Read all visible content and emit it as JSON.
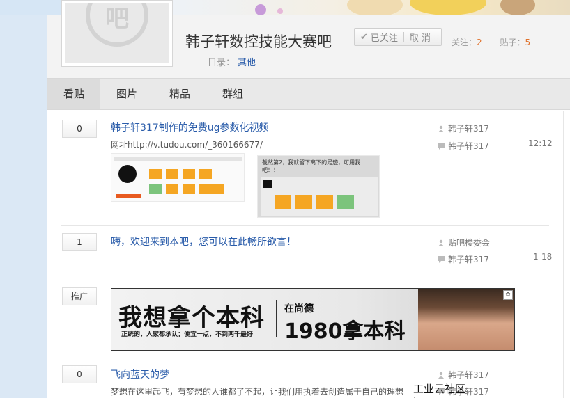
{
  "forum": {
    "title": "韩子轩数控技能大赛吧",
    "avatar_glyph": "吧",
    "follow": {
      "followed_label": "已关注",
      "cancel_label": "取 消"
    },
    "stats": {
      "follow_label": "关注：",
      "follow_count": "2",
      "post_label": "贴子：",
      "post_count": "5"
    },
    "catalog": {
      "label": "目录：",
      "value": "其他"
    }
  },
  "nav": {
    "tabs": [
      "看贴",
      "图片",
      "精品",
      "群组"
    ],
    "active": "看贴"
  },
  "threads": [
    {
      "replies": "0",
      "title": "韩子轩317制作的免费ug参数化视频",
      "excerpt": "网址http://v.tudou.com/_360166677/",
      "author": "韩子轩317",
      "last_reply": "韩子轩317",
      "time": "12:12",
      "thumb2_caption": "截然第2，我就留下离下的足迹，可用我吧！！"
    },
    {
      "replies": "1",
      "title": "嗨，欢迎来到本吧，您可以在此畅所欲言！",
      "author": "贴吧楼委会",
      "last_reply": "韩子轩317",
      "time": "1-18"
    },
    {
      "replies": "推广",
      "ad": {
        "main": "我想拿个本科",
        "sub": "正统的，人家都承认；便宜一点，不到两千最好",
        "brand": "在尚德",
        "right": "1980拿本科"
      }
    },
    {
      "replies": "0",
      "title": "飞向蓝天的梦",
      "excerpt": "梦想在这里起飞，有梦想的人谁都了不起，让我们用执着去创造属于自己的理想",
      "author": "韩子轩317",
      "last_reply": "韩子轩317"
    }
  ],
  "watermark": "工业云社区 http://top.caxa.com/",
  "colors": {
    "link": "#2a5caa",
    "count": "#e0722c"
  }
}
